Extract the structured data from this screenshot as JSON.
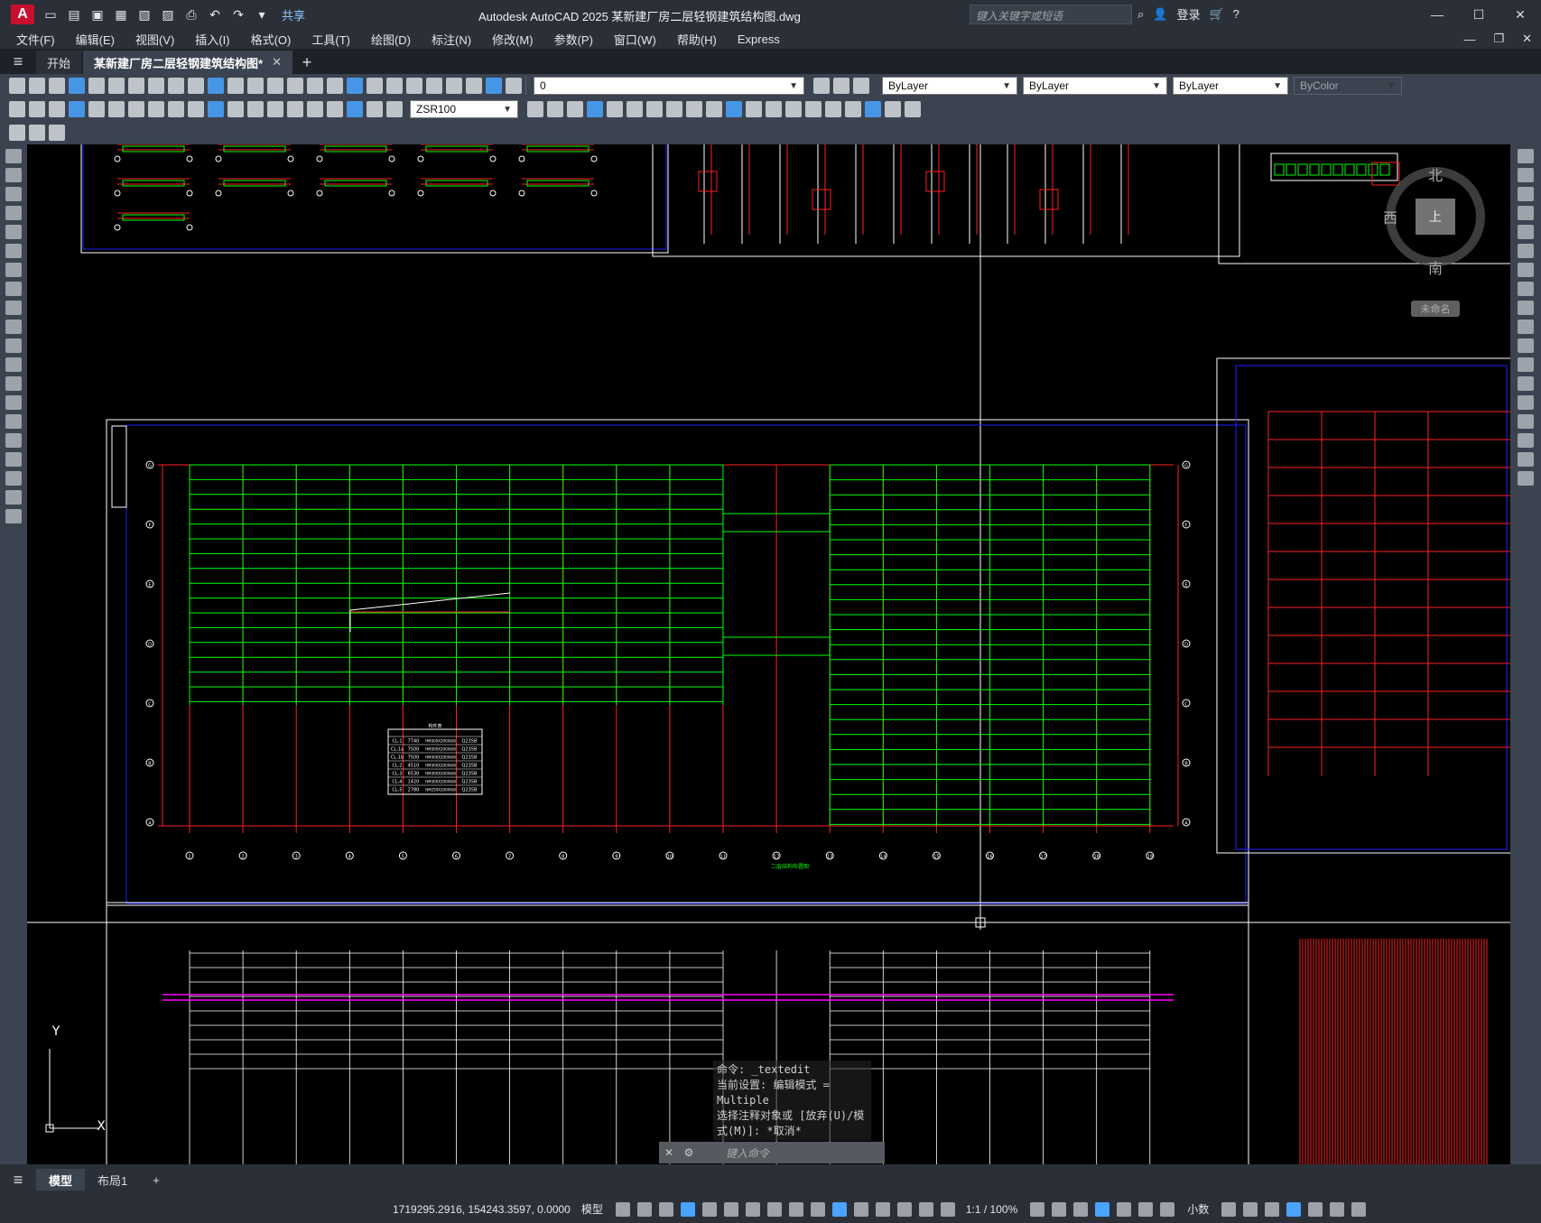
{
  "titlebar": {
    "logo": "A",
    "share": "共享",
    "title": "Autodesk AutoCAD 2025    某新建厂房二层轻钢建筑结构图.dwg",
    "search_placeholder": "键入关键字或短语",
    "login": "登录"
  },
  "menu": [
    "文件(F)",
    "编辑(E)",
    "视图(V)",
    "插入(I)",
    "格式(O)",
    "工具(T)",
    "绘图(D)",
    "标注(N)",
    "修改(M)",
    "参数(P)",
    "窗口(W)",
    "帮助(H)",
    "Express"
  ],
  "tabs": {
    "start": "开始",
    "doc": "某新建厂房二层轻钢建筑结构图*"
  },
  "toolbar": {
    "layer": "0",
    "color": "ByLayer",
    "linetype": "ByLayer",
    "lineweight": "ByLayer",
    "plotstyle": "ByColor",
    "dimstyle": "ZSR100"
  },
  "compass": {
    "north": "北",
    "south": "南",
    "west": "西",
    "top": "上",
    "ucs": "未命名"
  },
  "command": {
    "history": [
      "命令: _textedit",
      "当前设置: 编辑模式 = Multiple",
      "选择注释对象或 [放弃(U)/模式(M)]: *取消*"
    ],
    "placeholder": "键入命令"
  },
  "layout_tabs": {
    "model": "模型",
    "layout1": "布局1"
  },
  "status": {
    "coords": "1719295.2916, 154243.3597, 0.0000",
    "model": "模型",
    "scale": "1:1 / 100%",
    "units": "小数"
  },
  "drawing": {
    "plan_title": "二层结构布置图",
    "table_title": "构件表",
    "table_rows": [
      [
        "CL-1",
        "7740",
        "HM300X200X6/8",
        "Q235B"
      ],
      [
        "CL-1a",
        "7500",
        "HM300X200X6/8",
        "Q235B"
      ],
      [
        "CL-1b",
        "7500",
        "HM300X200X6/8",
        "Q235B"
      ],
      [
        "CL-2",
        "4510",
        "HM300X200X6/8",
        "Q235B"
      ],
      [
        "CL-3",
        "6530",
        "HM300X200X6/8",
        "Q235B"
      ],
      [
        "CL-4",
        "1420",
        "HM300X200X6/8",
        "Q235B"
      ],
      [
        "CL-5",
        "2780",
        "HM250X200X6/8",
        "Q235B"
      ]
    ],
    "axis_x": [
      "1",
      "2",
      "3",
      "4",
      "5",
      "6",
      "7",
      "8",
      "9",
      "10",
      "11",
      "12",
      "13",
      "14",
      "15",
      "16",
      "17",
      "18",
      "19"
    ],
    "axis_y": [
      "A",
      "B",
      "C",
      "D",
      "E",
      "F",
      "G"
    ],
    "colors": {
      "green": "#00ff00",
      "red": "#ff2020",
      "blue": "#2020ff",
      "white": "#ffffff",
      "magenta": "#ff00ff",
      "cyan": "#00e0e0"
    }
  }
}
